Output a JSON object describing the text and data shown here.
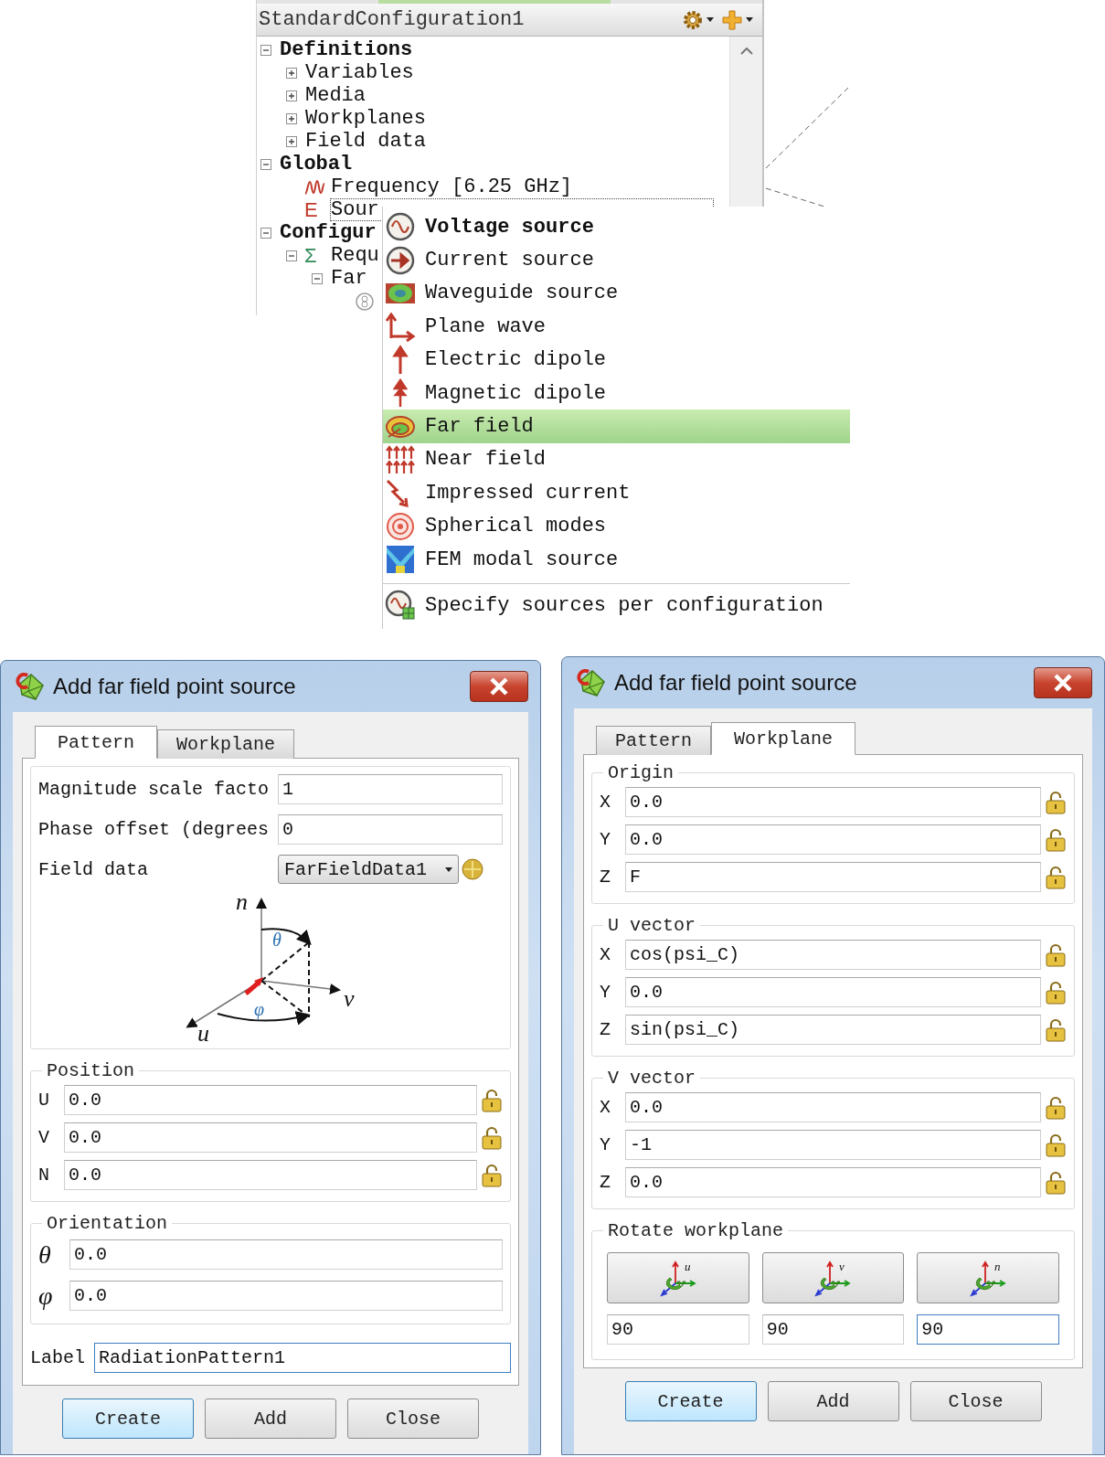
{
  "tree_panel": {
    "title": "StandardConfiguration1",
    "items": [
      {
        "label": "Definitions",
        "expanded": true,
        "selected": false,
        "children": [
          {
            "label": "Variables",
            "expanded": false,
            "selected": false
          },
          {
            "label": "Media",
            "expanded": false,
            "selected": false
          },
          {
            "label": "Workplanes",
            "expanded": false,
            "selected": false
          },
          {
            "label": "Field data",
            "expanded": false,
            "selected": false
          }
        ]
      },
      {
        "label": "Global",
        "expanded": true,
        "selected": false,
        "children": [
          {
            "label": "Frequency [6.25 GHz]",
            "kind": "frequency",
            "selected": false
          },
          {
            "label": "Sour",
            "kind": "letter",
            "icon_char": "E",
            "color": "#c0392b",
            "selected": true
          }
        ]
      },
      {
        "label": "Configur",
        "expanded": true,
        "selected": false,
        "children": [
          {
            "label": "Requ",
            "kind": "letter",
            "icon_char": "Σ",
            "color": "#2e8b57",
            "expanded": true,
            "selected": false,
            "children": [
              {
                "label": "Far",
                "expanded": true,
                "selected": false,
                "children": [
                  {
                    "kind": "far_field_point"
                  }
                ]
              }
            ]
          }
        ]
      }
    ]
  },
  "source_menu": {
    "items": [
      {
        "label": "Voltage source",
        "kind": "voltage",
        "default": true,
        "selected": false
      },
      {
        "label": "Current source",
        "kind": "current",
        "default": false,
        "selected": false
      },
      {
        "label": "Waveguide source",
        "kind": "waveguide",
        "default": false,
        "selected": false
      },
      {
        "label": "Plane wave",
        "kind": "plane_wave",
        "default": false,
        "selected": false
      },
      {
        "label": "Electric dipole",
        "kind": "electric_dipole",
        "default": false,
        "selected": false
      },
      {
        "label": "Magnetic dipole",
        "kind": "magnetic_dipole",
        "default": false,
        "selected": false
      },
      {
        "label": "Far field",
        "kind": "far_field",
        "default": false,
        "selected": true
      },
      {
        "label": "Near field",
        "kind": "near_field",
        "default": false,
        "selected": false
      },
      {
        "label": "Impressed current",
        "kind": "impressed_current",
        "default": false,
        "selected": false
      },
      {
        "label": "Spherical modes",
        "kind": "spherical_modes",
        "default": false,
        "selected": false
      },
      {
        "label": "FEM modal source",
        "kind": "fem_modal",
        "default": false,
        "selected": false
      }
    ],
    "extra_items": [
      {
        "label": "Specify sources per configuration",
        "kind": "per_configuration",
        "default": false,
        "selected": false
      }
    ]
  },
  "dialogs": [
    {
      "title": "Add far field point source",
      "tabs": [
        {
          "label": "Pattern",
          "selected": true
        },
        {
          "label": "Workplane",
          "selected": false
        }
      ],
      "panel": {
        "kind": "pattern",
        "fields": [
          {
            "label": "Magnitude scale facto",
            "value": "1"
          },
          {
            "label": "Phase offset (degrees",
            "value": "0"
          }
        ],
        "field_data": {
          "label": "Field data",
          "value": "FarFieldData1"
        },
        "diagram_labels": [
          "n",
          "θ",
          "v",
          "φ",
          "u"
        ],
        "groups": [
          {
            "title": "Position",
            "kind": "coordinates",
            "rows": [
              {
                "label": "U",
                "value": "0.0"
              },
              {
                "label": "V",
                "value": "0.0"
              },
              {
                "label": "N",
                "value": "0.0"
              }
            ]
          },
          {
            "title": "Orientation",
            "kind": "angles",
            "rows": [
              {
                "label": "θ",
                "value": "0.0"
              },
              {
                "label": "φ",
                "value": "0.0"
              }
            ]
          }
        ],
        "label_field": {
          "label": "Label",
          "value": "RadiationPattern1",
          "focused": true
        }
      },
      "buttons": [
        {
          "label": "Create",
          "default": true
        },
        {
          "label": "Add",
          "default": false
        },
        {
          "label": "Close",
          "default": false
        }
      ]
    },
    {
      "title": "Add far field point source",
      "tabs": [
        {
          "label": "Pattern",
          "selected": false
        },
        {
          "label": "Workplane",
          "selected": true
        }
      ],
      "panel": {
        "kind": "workplane",
        "groups": [
          {
            "title": "Origin",
            "kind": "coordinates",
            "rows": [
              {
                "label": "X",
                "value": "0.0"
              },
              {
                "label": "Y",
                "value": "0.0"
              },
              {
                "label": "Z",
                "value": "F"
              }
            ]
          },
          {
            "title": "U vector",
            "kind": "coordinates",
            "rows": [
              {
                "label": "X",
                "value": "cos(psi_C)"
              },
              {
                "label": "Y",
                "value": "0.0"
              },
              {
                "label": "Z",
                "value": "sin(psi_C)"
              }
            ]
          },
          {
            "title": "V vector",
            "kind": "coordinates",
            "rows": [
              {
                "label": "X",
                "value": "0.0"
              },
              {
                "label": "Y",
                "value": "-1"
              },
              {
                "label": "Z",
                "value": "0.0"
              }
            ]
          }
        ],
        "rotate": {
          "title": "Rotate workplane",
          "items": [
            {
              "axis": "u",
              "value": "90",
              "focused": false
            },
            {
              "axis": "v",
              "value": "90",
              "focused": false
            },
            {
              "axis": "n",
              "value": "90",
              "focused": true
            }
          ]
        }
      },
      "buttons": [
        {
          "label": "Create",
          "default": true
        },
        {
          "label": "Add",
          "default": false
        },
        {
          "label": "Close",
          "default": false
        }
      ]
    }
  ]
}
